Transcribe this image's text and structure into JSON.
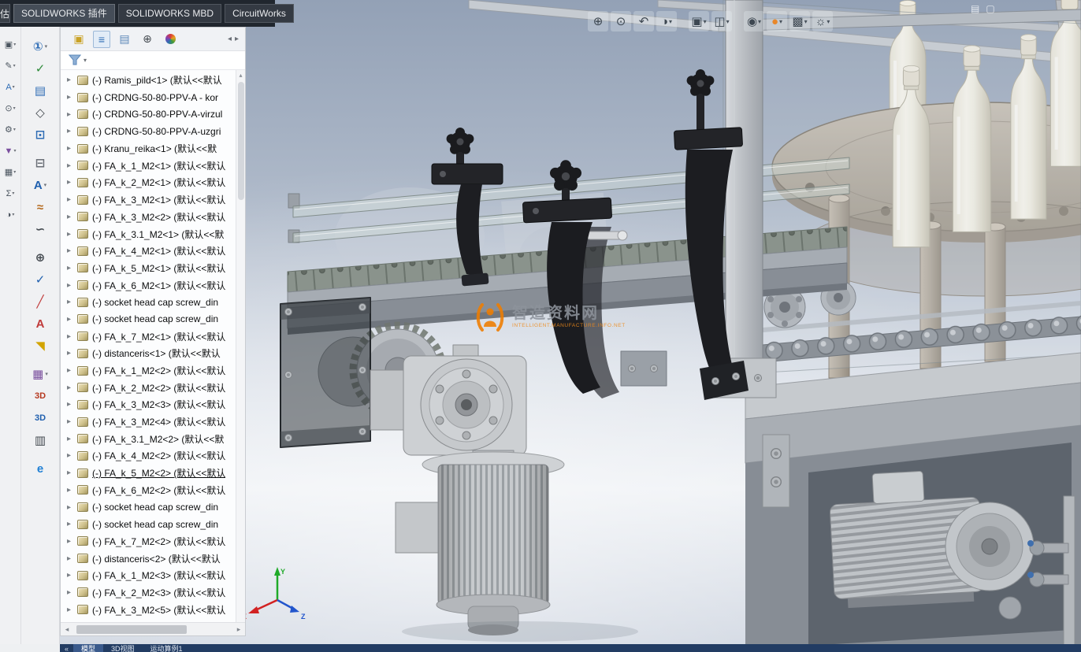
{
  "top_tabbar": {
    "partial_left": "估",
    "tabs": [
      "SOLIDWORKS 插件",
      "SOLIDWORKS MBD",
      "CircuitWorks"
    ],
    "active_index": 0
  },
  "glyphs": {
    "caret": "▾",
    "twist": "▸",
    "hscroll_left": "◂",
    "hscroll_right": "▸",
    "vscroll_up": "▴",
    "tab_left": "◂",
    "tab_right": "▸"
  },
  "far_left_toolbar": {
    "icons": [
      {
        "name": "orientation-flyout",
        "glyph": "▣",
        "color": "#4a545e"
      },
      {
        "name": "sketch-flyout",
        "glyph": "✎",
        "color": "#4a545e"
      },
      {
        "name": "annotation-flyout",
        "glyph": "A",
        "color": "#2f6db5"
      },
      {
        "name": "evaluate-flyout",
        "glyph": "⊙",
        "color": "#4a545e"
      },
      {
        "name": "settings-flyout",
        "glyph": "⚙",
        "color": "#4a545e"
      },
      {
        "name": "filter-flyout",
        "glyph": "▼",
        "color": "#7a4f9e"
      },
      {
        "name": "measure-flyout",
        "glyph": "▦",
        "color": "#4a545e"
      },
      {
        "name": "mass-props-flyout",
        "glyph": "Σ",
        "color": "#4a545e"
      },
      {
        "name": "section-flyout",
        "glyph": "◑",
        "color": "#4a545e"
      }
    ]
  },
  "left_toolbar": {
    "icons": [
      {
        "name": "balloon",
        "glyph": "①",
        "color": "#2f6db5",
        "caret": true
      },
      {
        "name": "spell-check",
        "glyph": "✓",
        "color": "#2e8b3a"
      },
      {
        "name": "linked-note",
        "glyph": "▤",
        "color": "#2f6db5"
      },
      {
        "name": "datum-feature",
        "glyph": "◇",
        "color": "#444a50"
      },
      {
        "name": "auto-balloon",
        "glyph": "⊡",
        "color": "#2f6db5"
      },
      {
        "name": "magnetic-line",
        "glyph": "⊟",
        "color": "#6b7077",
        "gap": true
      },
      {
        "name": "note",
        "glyph": "A",
        "color": "#1f5fae",
        "caret": true
      },
      {
        "name": "weld-symbol",
        "glyph": "≈",
        "color": "#b56a1e"
      },
      {
        "name": "surface-finish",
        "glyph": "∽",
        "color": "#444a50"
      },
      {
        "name": "geometric-tolerance",
        "glyph": "⊕",
        "color": "#444a50",
        "gap": true
      },
      {
        "name": "design-check",
        "glyph": "✓",
        "color": "#1f5fae"
      },
      {
        "name": "centerline",
        "glyph": "╱",
        "color": "#c03a3a"
      },
      {
        "name": "format-text",
        "glyph": "A",
        "color": "#c03a3a"
      },
      {
        "name": "revision-flag",
        "glyph": "◥",
        "color": "#d2a400"
      },
      {
        "name": "general-table",
        "glyph": "▦",
        "color": "#7a4f9e",
        "caret": true,
        "gap": true
      },
      {
        "name": "3d-view-capture",
        "glyph": "3D",
        "color": "#b5381f",
        "small": true
      },
      {
        "name": "3d-pdf-publish",
        "glyph": "3D",
        "color": "#1f5fae",
        "small": true
      },
      {
        "name": "dimension-set",
        "glyph": "▥",
        "color": "#444a50"
      },
      {
        "name": "edrawings-publish",
        "glyph": "e",
        "color": "#1f7fd4",
        "gap": true
      }
    ]
  },
  "headsup_toolbar": {
    "icons": [
      {
        "name": "zoom-in",
        "glyph": "⊕"
      },
      {
        "name": "zoom-to-fit",
        "glyph": "⊙"
      },
      {
        "name": "previous-view",
        "glyph": "↶"
      },
      {
        "name": "section-view",
        "glyph": "◑",
        "caret": true
      },
      {
        "name": "view-orientation",
        "glyph": "▣",
        "caret": true,
        "gap": true
      },
      {
        "name": "display-style",
        "glyph": "◫",
        "caret": true
      },
      {
        "name": "hide-show-items",
        "glyph": "◉",
        "caret": true,
        "gap": true
      },
      {
        "name": "edit-appearance",
        "glyph": "●",
        "color": "#e8872a",
        "caret": true
      },
      {
        "name": "apply-scene",
        "glyph": "▩",
        "caret": true
      },
      {
        "name": "view-settings",
        "glyph": "☼",
        "caret": true
      }
    ],
    "corner_icons": [
      {
        "name": "pane-collapse",
        "glyph": "▤"
      },
      {
        "name": "pane-float",
        "glyph": "▢"
      }
    ]
  },
  "tree_panel": {
    "header_icons": [
      {
        "name": "assembly-top",
        "glyph": "▣",
        "color": "#c9a227"
      },
      {
        "name": "featuremanager-tab",
        "glyph": "≡",
        "color": "#2f6db5",
        "active": true
      },
      {
        "name": "propertymanager-tab",
        "glyph": "▤",
        "color": "#5b87b8"
      },
      {
        "name": "dimxpertmanager-tab",
        "glyph": "⊕",
        "color": "#444a50"
      },
      {
        "name": "displaymanager-tab",
        "glyph": "",
        "color": ""
      }
    ],
    "items": [
      {
        "label": "(-) Ramis_pild<1> (默认<<默认"
      },
      {
        "label": "(-) CRDNG-50-80-PPV-A - kor"
      },
      {
        "label": "(-) CRDNG-50-80-PPV-A-virzul"
      },
      {
        "label": "(-) CRDNG-50-80-PPV-A-uzgri"
      },
      {
        "label": "(-) Kranu_reika<1> (默认<<默"
      },
      {
        "label": "(-) FA_k_1_M2<1> (默认<<默认"
      },
      {
        "label": "(-) FA_k_2_M2<1> (默认<<默认"
      },
      {
        "label": "(-) FA_k_3_M2<1> (默认<<默认"
      },
      {
        "label": "(-) FA_k_3_M2<2> (默认<<默认"
      },
      {
        "label": "(-) FA_k_3.1_M2<1> (默认<<默"
      },
      {
        "label": "(-) FA_k_4_M2<1> (默认<<默认"
      },
      {
        "label": "(-) FA_k_5_M2<1> (默认<<默认"
      },
      {
        "label": "(-) FA_k_6_M2<1> (默认<<默认"
      },
      {
        "label": "(-) socket head cap screw_din"
      },
      {
        "label": "(-) socket head cap screw_din"
      },
      {
        "label": "(-) FA_k_7_M2<1> (默认<<默认"
      },
      {
        "label": "(-) distanceris<1> (默认<<默认"
      },
      {
        "label": "(-) FA_k_1_M2<2> (默认<<默认"
      },
      {
        "label": "(-) FA_k_2_M2<2> (默认<<默认"
      },
      {
        "label": "(-) FA_k_3_M2<3> (默认<<默认"
      },
      {
        "label": "(-) FA_k_3_M2<4> (默认<<默认"
      },
      {
        "label": "(-) FA_k_3.1_M2<2> (默认<<默"
      },
      {
        "label": "(-) FA_k_4_M2<2> (默认<<默认"
      },
      {
        "label": "(-) FA_k_5_M2<2> (默认<<默认",
        "underlined": true
      },
      {
        "label": "(-) FA_k_6_M2<2> (默认<<默认"
      },
      {
        "label": "(-) socket head cap screw_din"
      },
      {
        "label": "(-) socket head cap screw_din"
      },
      {
        "label": "(-) FA_k_7_M2<2> (默认<<默认"
      },
      {
        "label": "(-) distanceris<2> (默认<<默认"
      },
      {
        "label": "(-) FA_k_1_M2<3> (默认<<默认"
      },
      {
        "label": "(-) FA_k_2_M2<3> (默认<<默认"
      },
      {
        "label": "(-) FA_k_3_M2<5> (默认<<默认"
      }
    ]
  },
  "statusbar": {
    "back": "«",
    "tabs": [
      "模型",
      "3D视图",
      "运动算例1"
    ],
    "active_index": 0
  },
  "watermark": {
    "title": "智造资料网",
    "subtitle": "INTELLIGENT.MANUFACTURE.INFO.NET",
    "orange": "#ef7d00"
  },
  "triad": {
    "x": "X",
    "y": "Y",
    "z": "Z"
  },
  "colors": {
    "viewport_top": "#93a1b6",
    "statusbar_blue": "#223c63",
    "tab_strip": "#20262e"
  }
}
